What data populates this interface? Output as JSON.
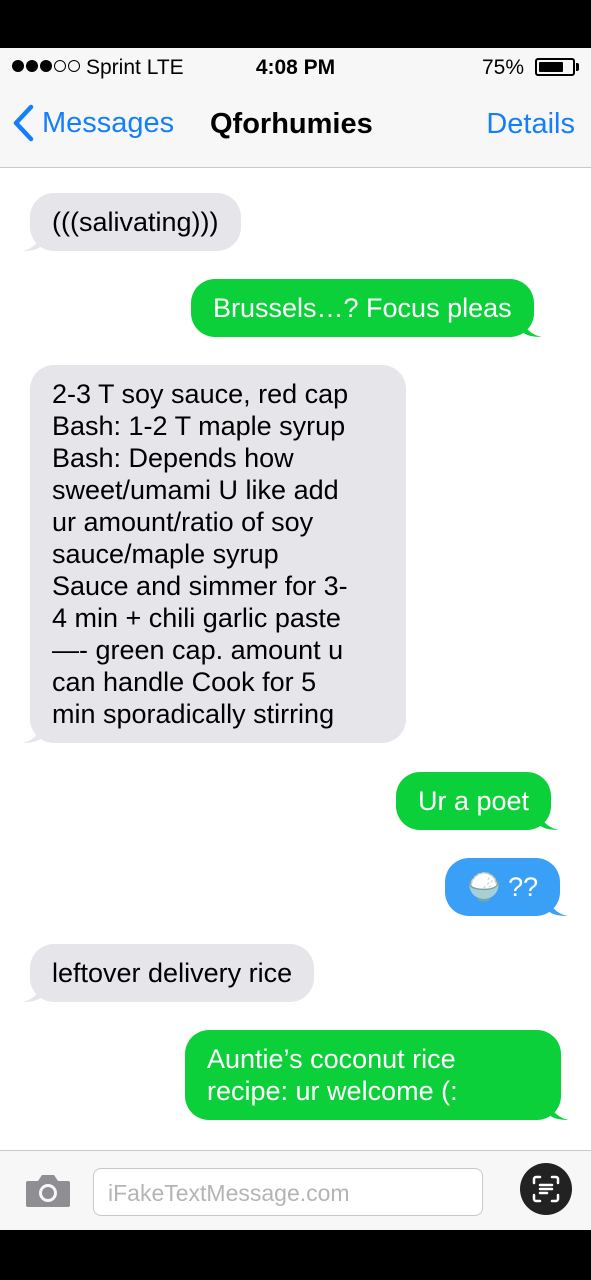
{
  "status_bar": {
    "carrier": "Sprint  LTE",
    "time": "4:08 PM",
    "battery": "75%",
    "battery_level": 0.75
  },
  "nav": {
    "back_label": "Messages",
    "title": "Qforhumies",
    "details_label": "Details"
  },
  "messages": [
    {
      "direction": "incoming",
      "text": "(((salivating)))"
    },
    {
      "direction": "outgoing",
      "text": "Brussels…? Focus pleas"
    },
    {
      "direction": "incoming",
      "lines": [
        "2-3 T soy sauce, red cap",
        "Bash: 1-2 T maple syrup",
        "Bash: Depends how",
        "sweet/umami U like add",
        "ur amount/ratio of soy",
        "sauce/maple syrup",
        "Sauce and simmer for 3-",
        "4 min + chili garlic paste",
        "—- green cap. amount u",
        "can handle Cook for 5",
        "min sporadically stirring"
      ]
    },
    {
      "direction": "outgoing",
      "text": "Ur a poet"
    },
    {
      "direction": "outgoing-blue",
      "text": "🍚 ??"
    },
    {
      "direction": "incoming",
      "text": "leftover delivery rice"
    },
    {
      "direction": "outgoing",
      "lines": [
        "Auntie’s coconut rice",
        "recipe: ur welcome (:"
      ]
    }
  ],
  "input": {
    "placeholder": "iFakeTextMessage.com"
  },
  "colors": {
    "ios_blue": "#147efb",
    "green_bubble": "#0cd03a",
    "blue_bubble": "#3a9ff7",
    "gray_bubble": "#e5e5ea"
  },
  "icons": [
    "chevron-left-icon",
    "camera-icon",
    "scan-text-icon",
    "rice-bowl-icon"
  ]
}
